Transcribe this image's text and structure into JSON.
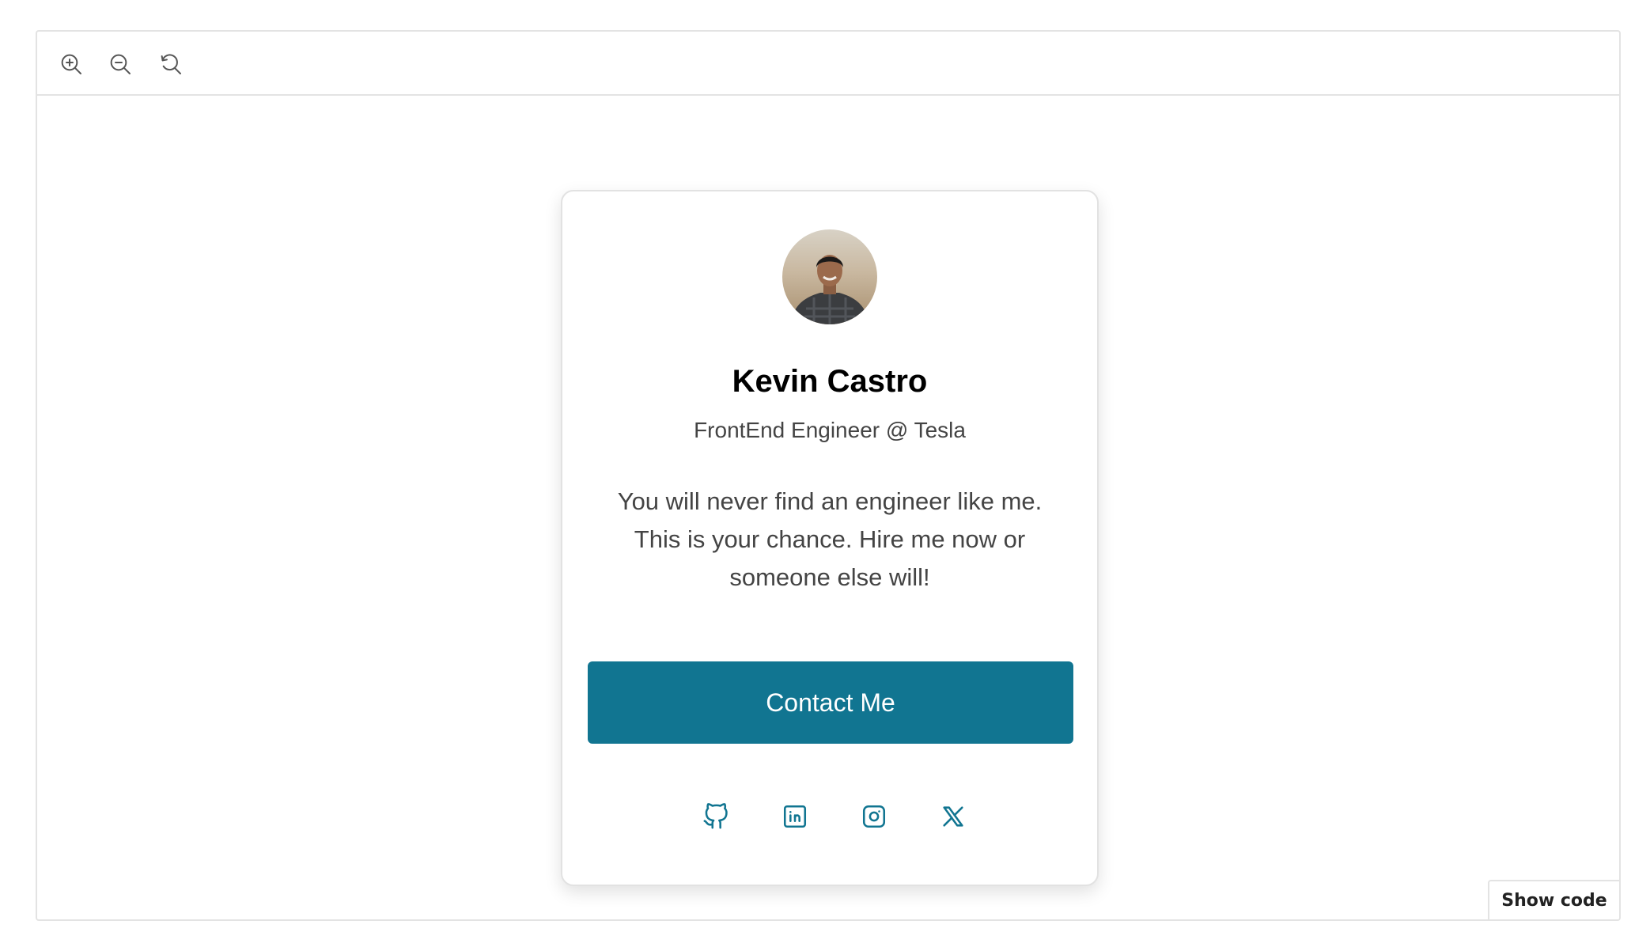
{
  "toolbar": {
    "zoom_in_icon": "zoom-in-icon",
    "zoom_out_icon": "zoom-out-icon",
    "reset_icon": "reset-zoom-icon"
  },
  "profile": {
    "name": "Kevin Castro",
    "role": "FrontEnd Engineer @ Tesla",
    "bio": "You will never find an engineer like me. This is your chance. Hire me now or someone else will!",
    "contact_label": "Contact Me"
  },
  "socials": [
    {
      "icon": "github-icon"
    },
    {
      "icon": "linkedin-icon"
    },
    {
      "icon": "instagram-icon"
    },
    {
      "icon": "x-twitter-icon"
    }
  ],
  "footer": {
    "show_code_label": "Show code"
  },
  "colors": {
    "accent": "#117591",
    "border": "#e3e3e3",
    "text_muted": "#444444"
  }
}
